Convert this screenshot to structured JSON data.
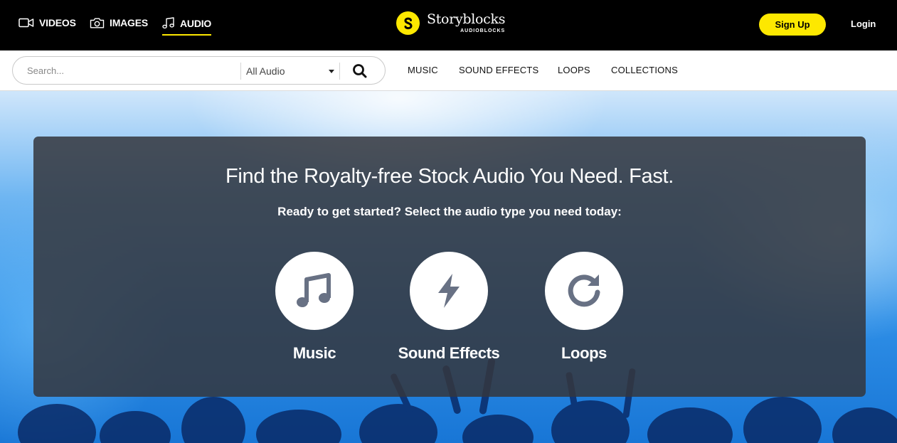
{
  "topbar": {
    "media_tabs": [
      {
        "label": "VIDEOS",
        "icon": "video-camera-icon",
        "active": false
      },
      {
        "label": "IMAGES",
        "icon": "photo-camera-icon",
        "active": false
      },
      {
        "label": "AUDIO",
        "icon": "music-note-icon",
        "active": true
      }
    ],
    "logo": {
      "name": "Storyblocks",
      "sub": "AUDIOBLOCKS"
    },
    "signup_label": "Sign Up",
    "login_label": "Login"
  },
  "searchbar": {
    "placeholder": "Search...",
    "category_selected": "All Audio"
  },
  "nav": {
    "links": [
      "MUSIC",
      "SOUND EFFECTS",
      "LOOPS",
      "COLLECTIONS"
    ]
  },
  "hero": {
    "title": "Find the Royalty-free Stock Audio You Need. Fast.",
    "subtitle": "Ready to get started? Select the audio type you need today:",
    "options": [
      {
        "label": "Music",
        "icon": "music-note-icon"
      },
      {
        "label": "Sound Effects",
        "icon": "lightning-bolt-icon"
      },
      {
        "label": "Loops",
        "icon": "refresh-loop-icon"
      }
    ]
  },
  "colors": {
    "accent_yellow": "#fde800",
    "topbar_bg": "#000000",
    "card_bg": "#34373e",
    "icon_gray": "#687184"
  }
}
